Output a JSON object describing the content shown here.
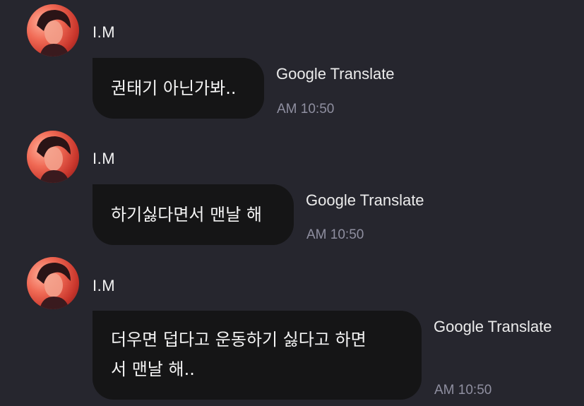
{
  "messages": [
    {
      "sender": "I.M",
      "text": "권태기 아닌가봐..",
      "translate_label": "Google Translate",
      "time": "AM 10:50"
    },
    {
      "sender": "I.M",
      "text": "하기싫다면서 맨날 해",
      "translate_label": "Google Translate",
      "time": "AM 10:50"
    },
    {
      "sender": "I.M",
      "text_line1": "더우면 덥다고 운동하기 싫다고 하면",
      "text_line2": "서 맨날 해..",
      "translate_label": "Google Translate",
      "time": "AM 10:50"
    }
  ],
  "colors": {
    "background": "#26262e",
    "bubble": "#151516",
    "text": "#f4f4f4",
    "time": "#8f8fa0"
  }
}
